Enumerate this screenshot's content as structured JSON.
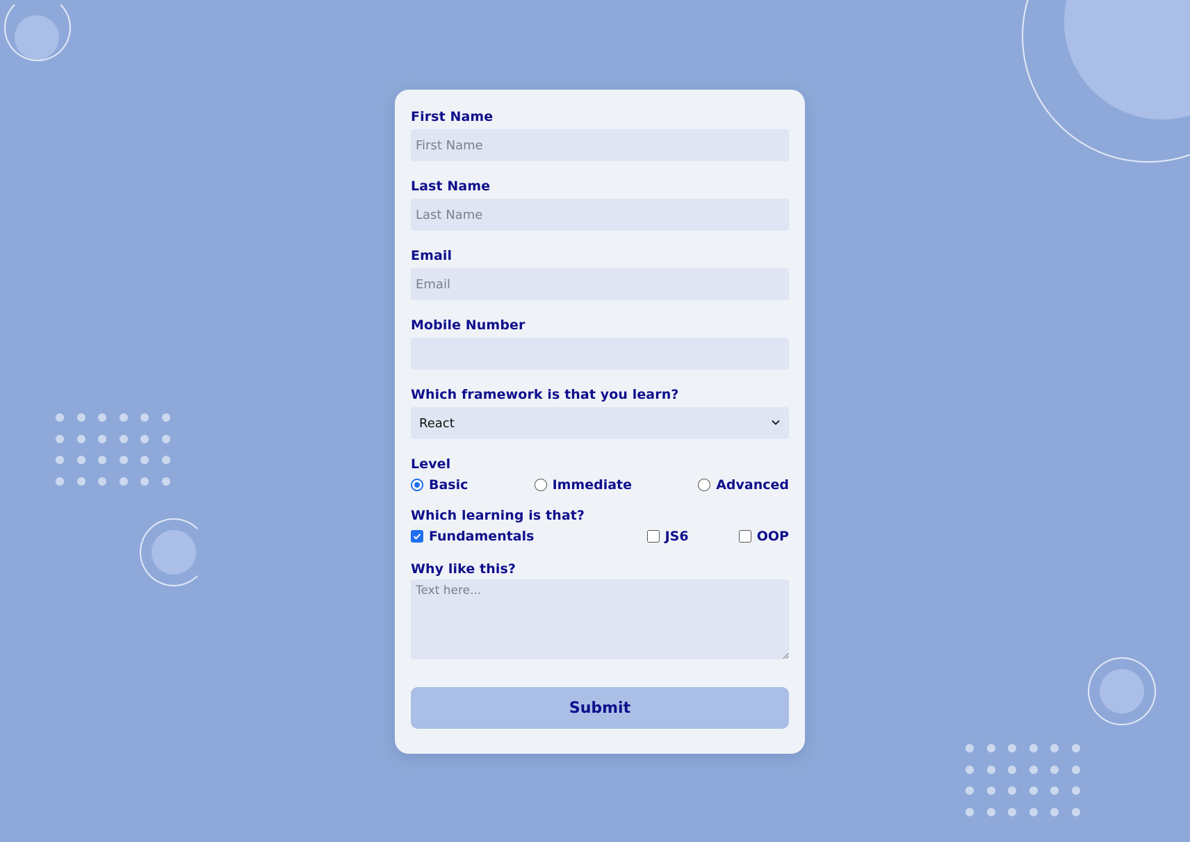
{
  "form": {
    "first_name": {
      "label": "First Name",
      "placeholder": "First Name",
      "value": ""
    },
    "last_name": {
      "label": "Last Name",
      "placeholder": "Last Name",
      "value": ""
    },
    "email": {
      "label": "Email",
      "placeholder": "Email",
      "value": ""
    },
    "mobile": {
      "label": "Mobile Number",
      "placeholder": "",
      "value": ""
    },
    "framework": {
      "label": "Which framework is that you learn?",
      "selected": "React"
    },
    "level": {
      "label": "Level",
      "options": [
        {
          "label": "Basic",
          "checked": true
        },
        {
          "label": "Immediate",
          "checked": false
        },
        {
          "label": "Advanced",
          "checked": false
        }
      ]
    },
    "learning": {
      "label": "Which learning is that?",
      "options": [
        {
          "label": "Fundamentals",
          "checked": true
        },
        {
          "label": "JS6",
          "checked": false
        },
        {
          "label": "OOP",
          "checked": false
        }
      ]
    },
    "why": {
      "label": "Why like this?",
      "placeholder": "Text here..."
    },
    "submit_label": "Submit"
  },
  "colors": {
    "background": "#8ea9d9",
    "card": "#eff3f8",
    "input_bg": "#dfe5f2",
    "label": "#0f0f8c",
    "accent": "#1f6ef0",
    "button_bg": "#abbfe6"
  },
  "icons": {
    "select": "chevron-down-icon",
    "checked_box": "checkmark-icon"
  }
}
